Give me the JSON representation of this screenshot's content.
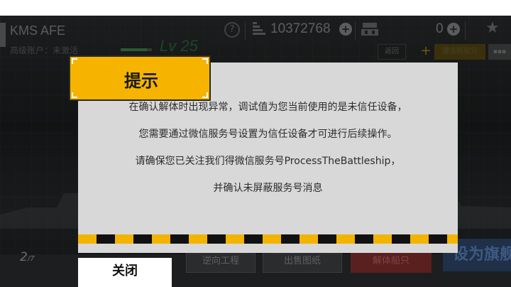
{
  "top_bar": {
    "ship_name": "KMS AFE",
    "account_status": "高级账户：未激活",
    "level": "Lv 25",
    "level_progress": 0.85,
    "help_glyph": "?",
    "resource_value": "10372768",
    "count_value": "0",
    "plus_glyph": "+",
    "star_glyph": "★",
    "back_label": "返回",
    "add_glyph": "+",
    "build_label": "建造新船只",
    "mini_label": "▪▪▪"
  },
  "dialog": {
    "title": "提示",
    "lines": [
      "在确认解体时出现异常，调试值为您当前使用的是未信任设备，",
      "您需要通过微信服务号设置为信任设备才可进行后续操作。",
      "请确保您已关注我们得微信服务号ProcessTheBattleship，",
      "并确认未屏蔽服务号消息"
    ],
    "close_label": "关闭"
  },
  "bottom_bar": {
    "page_current": "2",
    "page_total": "/7",
    "reverse_label": "逆向工程",
    "sell_label": "出售图纸",
    "dismantle_label": "解体船只",
    "flagship_label": "设为旗舰"
  },
  "colors": {
    "accent_yellow": "#f6b400",
    "dialog_bg": "#d8d8d8",
    "dismantle_red": "#5a1f1f",
    "flagship_blue": "#1f3048"
  },
  "icons": [
    "help-icon",
    "resource-icon",
    "plus-icon",
    "shop-icon",
    "star-icon"
  ]
}
